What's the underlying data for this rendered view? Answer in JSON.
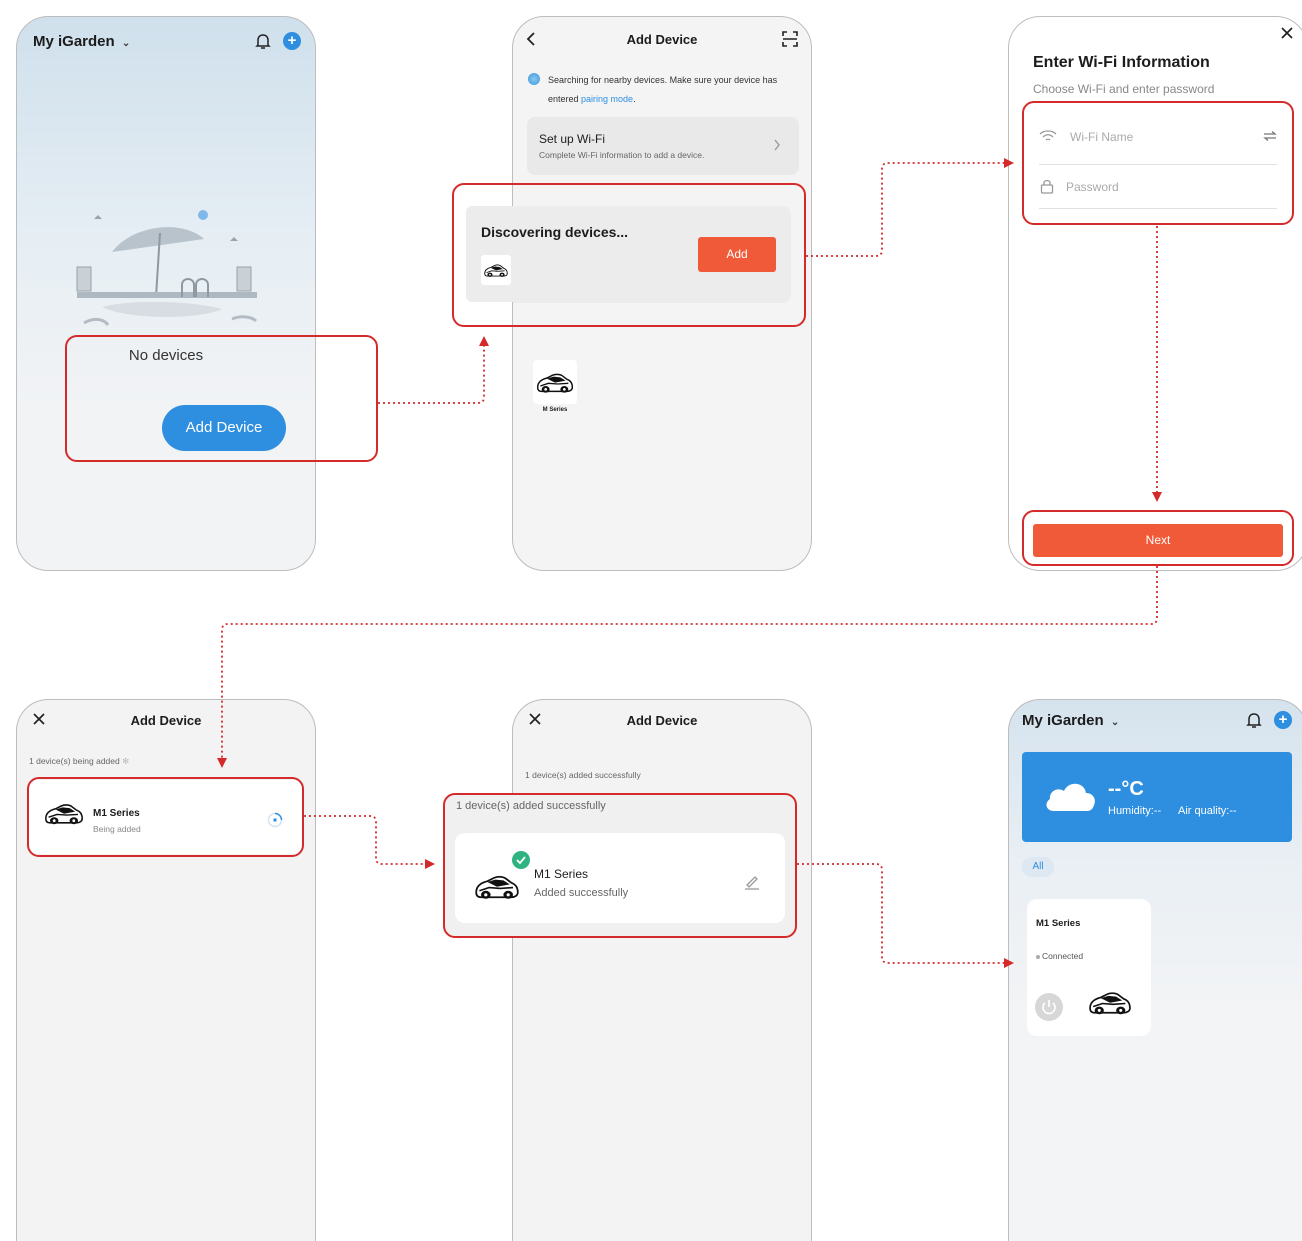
{
  "screen1": {
    "home_title": "My iGarden",
    "empty_text": "No devices",
    "add_device_label": "Add Device"
  },
  "screen2": {
    "title": "Add Device",
    "search_text": "Searching for nearby devices. Make sure your device has entered ",
    "pairing_link": "pairing mode",
    "period": ".",
    "wifi_title": "Set up Wi-Fi",
    "wifi_sub": "Complete Wi-Fi information to add a device.",
    "discovering": "Discovering devices...",
    "add_label": "Add",
    "device_label": "M Series"
  },
  "screen3": {
    "title": "Enter Wi-Fi Information",
    "subtitle": "Choose Wi-Fi and enter password",
    "wifi_placeholder": "Wi-Fi Name",
    "password_placeholder": "Password",
    "next_label": "Next"
  },
  "screen4": {
    "title": "Add Device",
    "status": "1 device(s) being added",
    "device_name": "M1 Series",
    "device_status": "Being added"
  },
  "screen5": {
    "title": "Add Device",
    "status": "1 device(s) added successfully",
    "status_callout": "1 device(s) added successfully",
    "device_name": "M1 Series",
    "device_status": "Added successfully"
  },
  "screen6": {
    "home_title": "My iGarden",
    "temperature": "--°C",
    "humidity": "Humidity:--",
    "air_quality": "Air quality:--",
    "tab_all": "All",
    "device_name": "M1 Series",
    "device_status": "Connected"
  },
  "colors": {
    "accent_blue": "#2e8ee0",
    "accent_orange": "#f05a38",
    "highlight_red": "#d42a2a",
    "success_green": "#2fb383"
  },
  "icons": [
    "chevron-down-icon",
    "bell-icon",
    "plus-icon",
    "back-icon",
    "scan-icon",
    "close-icon",
    "wifi-icon",
    "lock-icon",
    "swap-icon",
    "spinner-icon",
    "check-icon",
    "edit-icon",
    "cloud-icon",
    "power-icon",
    "chevron-right-icon",
    "robot-mower-icon"
  ]
}
